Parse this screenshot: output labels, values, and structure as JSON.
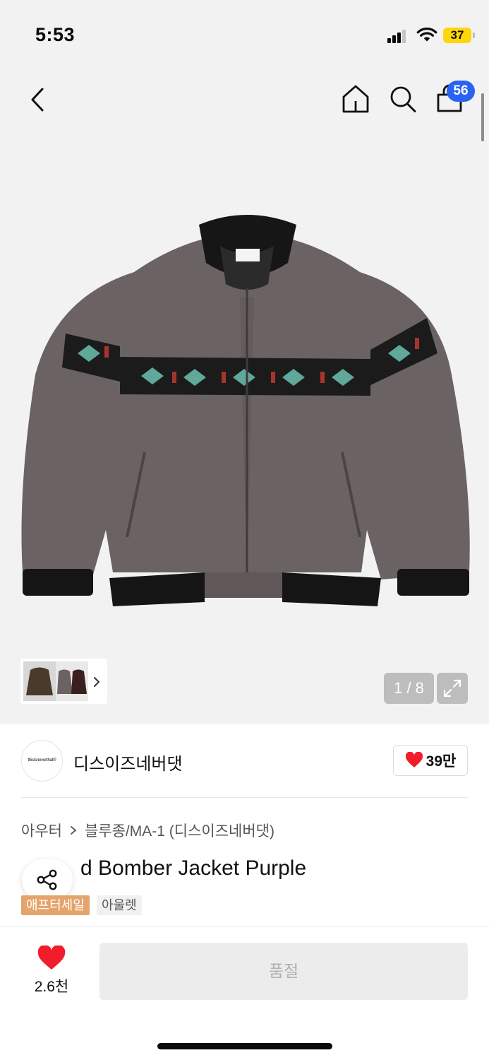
{
  "status_bar": {
    "time": "5:53",
    "battery": "37"
  },
  "nav": {
    "cart_badge": "56"
  },
  "gallery": {
    "page_indicator": "1 / 8"
  },
  "brand": {
    "logo_text": "thisisneverthat®",
    "name": "디스이즈네버댓",
    "likes": "39만"
  },
  "breadcrumb": {
    "category": "아우터",
    "subcategory": "블루종/MA-1 (디스이즈네버댓)"
  },
  "product": {
    "title_visible": "d Bomber Jacket Purple",
    "tags": [
      "애프터세일",
      "아울렛"
    ]
  },
  "bottom_bar": {
    "wish_count": "2.6천",
    "buy_button": "품절"
  },
  "colors": {
    "accent": "#2a62f2",
    "heart": "#f21d2a",
    "sale_tag": "#e5a46b",
    "jacket": "#6b6263"
  }
}
